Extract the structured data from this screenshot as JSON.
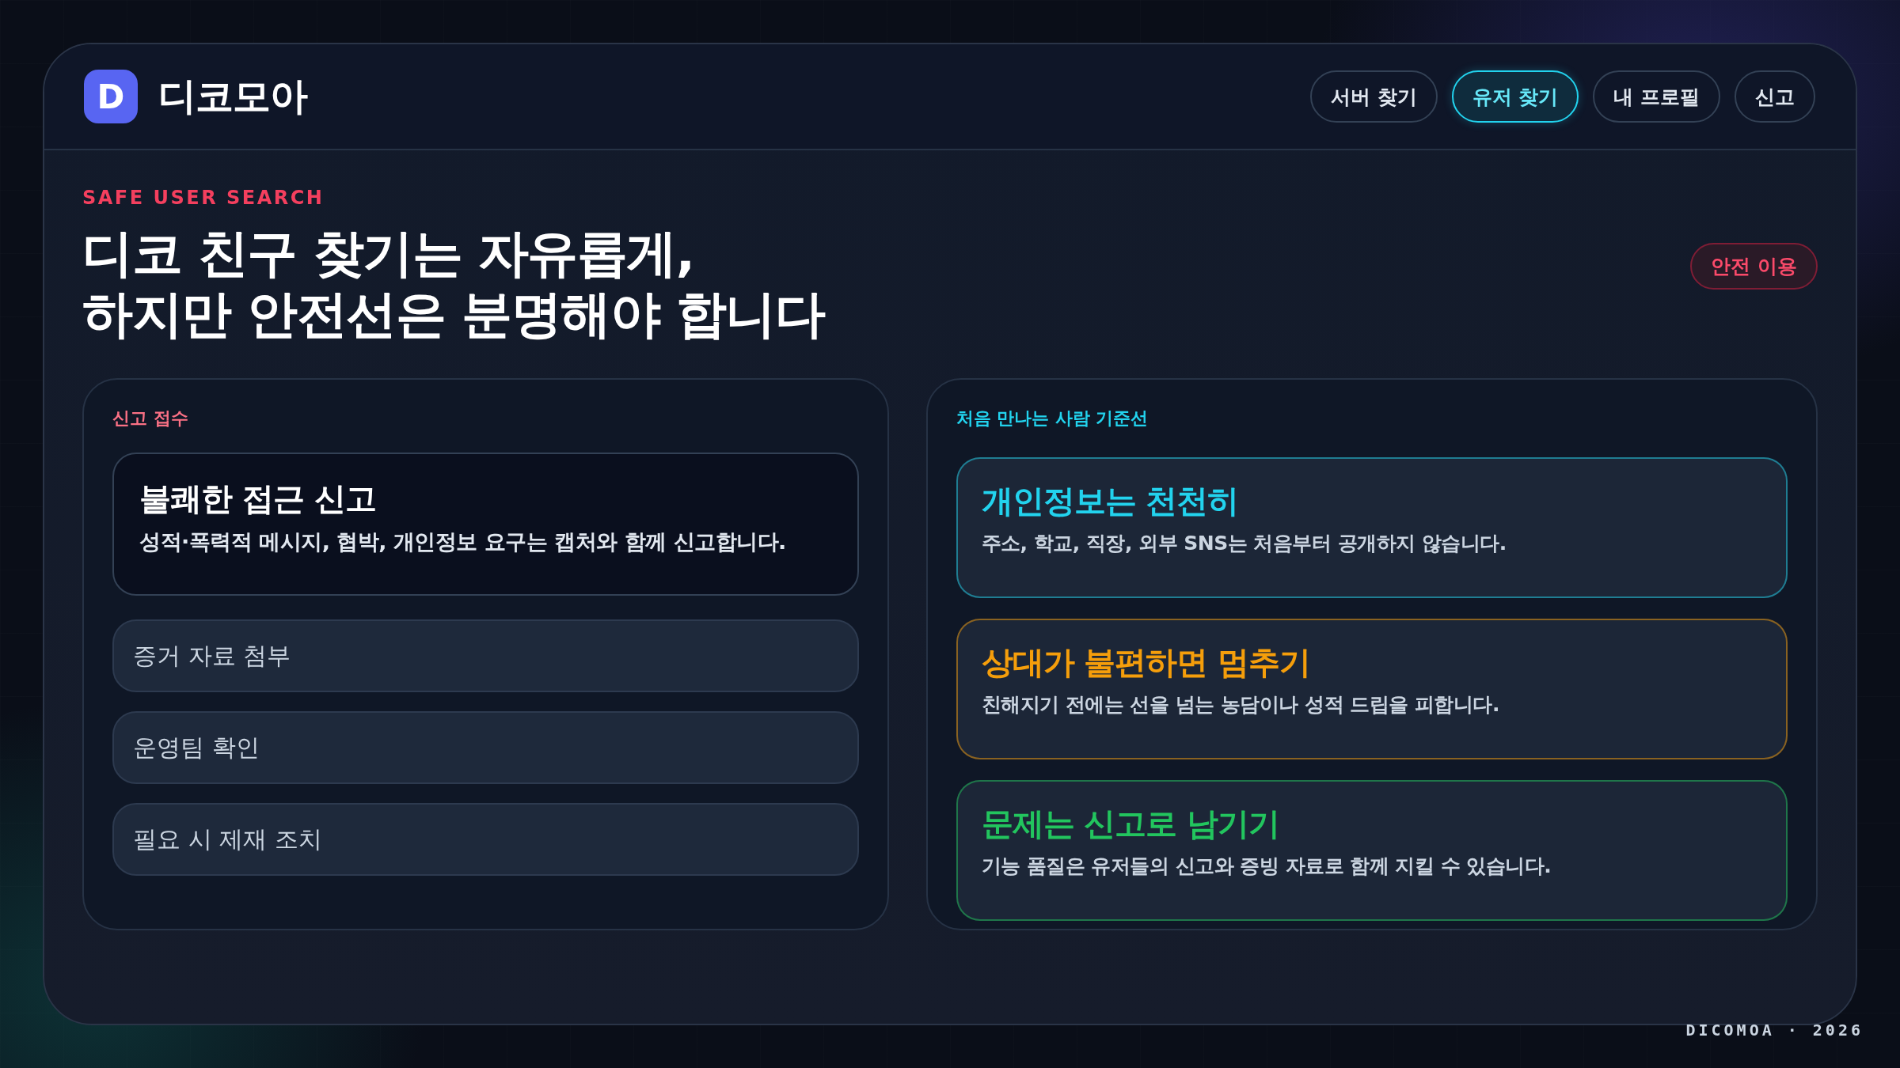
{
  "brand": {
    "logo_letter": "D",
    "name": "디코모아"
  },
  "nav": [
    {
      "label": "서버 찾기",
      "selected": false
    },
    {
      "label": "유저 찾기",
      "selected": true
    },
    {
      "label": "내 프로필",
      "selected": false
    },
    {
      "label": "신고",
      "selected": false
    }
  ],
  "hero": {
    "eyebrow": "SAFE USER SEARCH",
    "title_lines": [
      "디코 친구 찾기는 자유롭게,",
      "하지만 안전선은 분명해야 합니다"
    ],
    "tag": "안전 이용"
  },
  "report_panel": {
    "label": "신고 접수",
    "highlight": {
      "title": "불쾌한 접근 신고",
      "description": "성적·폭력적 메시지, 협박, 개인정보 요구는 캡처와 함께 신고합니다."
    },
    "steps": [
      "증거 자료 첨부",
      "운영팀 확인",
      "필요 시 제재 조치"
    ]
  },
  "guidelines_panel": {
    "label": "처음 만나는 사람 기준선",
    "tips": [
      {
        "title": "개인정보는 천천히",
        "description": "주소, 학교, 직장, 외부 SNS는 처음부터 공개하지 않습니다.",
        "color": "#22d3ee"
      },
      {
        "title": "상대가 불편하면 멈추기",
        "description": "친해지기 전에는 선을 넘는 농담이나 성적 드립을 피합니다.",
        "color": "#f59e0b"
      },
      {
        "title": "문제는 신고로 남기기",
        "description": "기능 품질은 유저들의 신고와 증빙 자료로 함께 지킬 수 있습니다.",
        "color": "#22c55e"
      }
    ]
  },
  "footer": "DICOMOA · 2026"
}
